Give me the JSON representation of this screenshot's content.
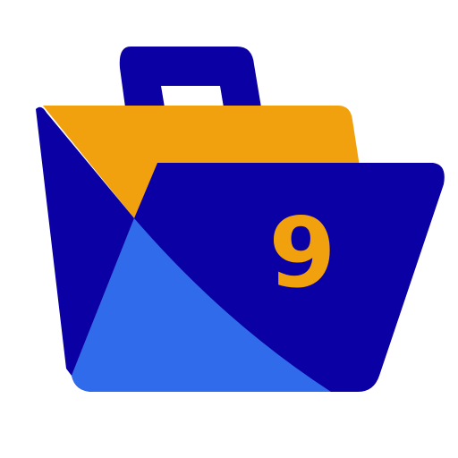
{
  "icon": {
    "name": "briefcase-folder-icon",
    "badge_text": "9"
  },
  "colors": {
    "background": "#ffffff",
    "handle": "#0a00a3",
    "back_panel": "#f2a10e",
    "front_dark": "#0a00a3",
    "front_light": "#2f6bea",
    "badge": "#f2a10e"
  }
}
